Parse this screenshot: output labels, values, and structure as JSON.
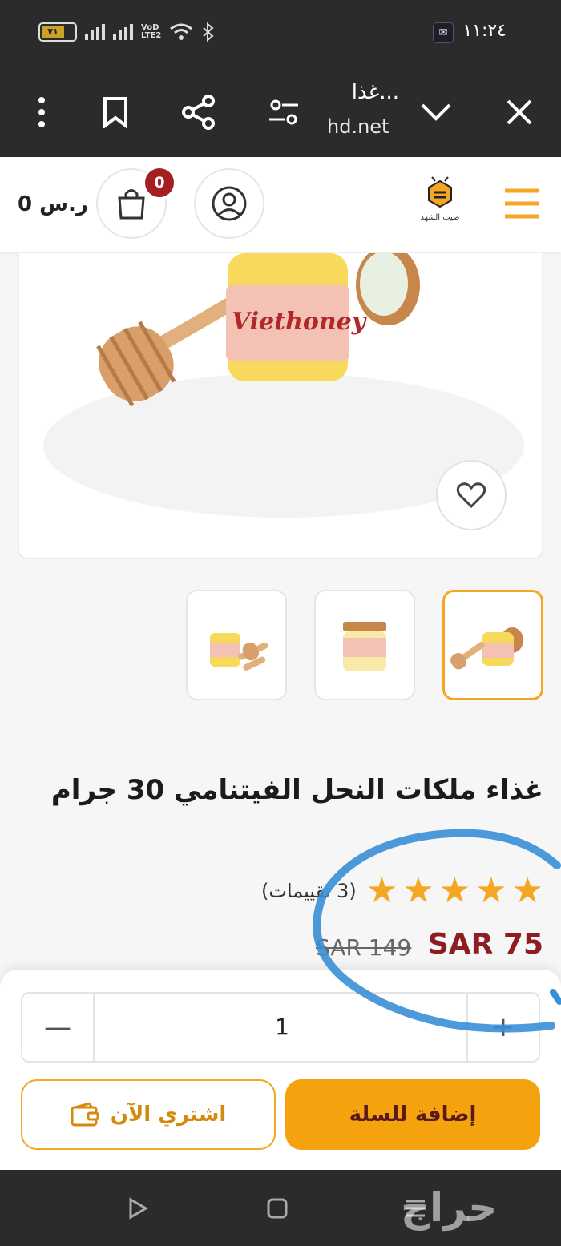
{
  "status_bar": {
    "time": "١١:٢٤",
    "battery_level": "٧١",
    "network_label_top": "VoD",
    "network_label_bottom": "LTE2"
  },
  "browser": {
    "page_title": "غذا...",
    "url": "hd.net"
  },
  "header": {
    "cart_total": "0 ر.س",
    "cart_count": "0",
    "logo_text": "صيب الشهد"
  },
  "product": {
    "title": "غذاء ملكات النحل الفيتنامي 30 جرام",
    "rating_stars": 5,
    "rating_count_text": "(3 تقييمات)",
    "price": "SAR 75",
    "old_price": "SAR 149",
    "label_text": "Viethoney"
  },
  "quantity": {
    "minus_symbol": "—",
    "value": "1",
    "plus_symbol": "+"
  },
  "actions": {
    "buy_now_label": "اشتري الآن",
    "add_to_cart_label": "إضافة للسلة"
  },
  "watermark": "حراج",
  "colors": {
    "accent": "#f5a623",
    "price": "#8e1c20",
    "badge": "#a51f22",
    "annotation": "#3a8fd6"
  }
}
